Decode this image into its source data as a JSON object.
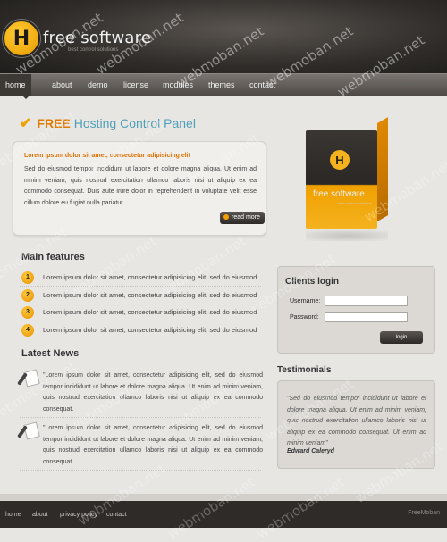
{
  "header": {
    "logo_letter": "H",
    "brand": "free software",
    "tagline": "best control solutions"
  },
  "nav": {
    "items": [
      "home",
      "about",
      "demo",
      "license",
      "modules",
      "themes",
      "contact"
    ],
    "active": "home"
  },
  "hero": {
    "title_free": "FREE",
    "title_rest": "Hosting Control Panel"
  },
  "intro": {
    "heading": "Lorem ipsum dolor sit amet, consectetur adipisicing elit",
    "text": "Sed do eiusmod tempor incididunt ut labore et dolore magna aliqua. Ut enim ad minim veniam, quis nostrud exercitation ullamco laboris nisi ut aliquip ex ea commodo consequat. Duis aute irure dolor in reprehenderit in voluptate velit esse cillum dolore eu fugiat nulla pariatur.",
    "read_more": "read more"
  },
  "product_box": {
    "logo_letter": "H",
    "name": "free software",
    "tagline": "best control solutions"
  },
  "features": {
    "title": "Main features",
    "items": [
      {
        "number": "1",
        "text": "Lorem ipsum dolor sit amet, consectetur adipisicing elit, sed do eiusmod"
      },
      {
        "number": "2",
        "text": "Lorem ipsum dolor sit amet, consectetur adipisicing elit, sed do eiusmod"
      },
      {
        "number": "3",
        "text": "Lorem ipsum dolor sit amet, consectetur adipisicing elit, sed do eiusmod"
      },
      {
        "number": "4",
        "text": "Lorem ipsum dolor sit amet, consectetur adipisicing elit, sed do eiusmod"
      }
    ]
  },
  "news": {
    "title": "Latest News",
    "items": [
      {
        "text": "\"Lorem ipsum dolor sit amet, consectetur adipisicing elit, sed do eiusmod tempor incididunt ut labore et dolore magna aliqua. Ut enim ad minim veniam, quis nostrud exercitation ullamco laboris nisi ut aliquip ex ea commodo consequat."
      },
      {
        "text": "\"Lorem ipsum dolor sit amet, consectetur adipisicing elit, sed do eiusmod tempor incididunt ut labore et dolore magna aliqua. Ut enim ad minim veniam, quis nostrud exercitation ullamco laboris nisi ut aliquip ex ea commodo consequat."
      }
    ]
  },
  "login": {
    "title": "Clients login",
    "username_label": "Username:",
    "password_label": "Password:",
    "username_value": "",
    "password_value": "",
    "button": "login"
  },
  "testimonials": {
    "title": "Testimonials",
    "quote": "\"Sed do eiusmod tempor incididunt ut labore et dolore magna aliqua. Ut enim ad minim veniam, quis nostrud exercitation ullamco laboris nisi ut aliquip ex ea commodo consequat. Ut enim ad minim veniam\"",
    "author": "Edward Caleryd"
  },
  "footer": {
    "links": [
      "home",
      "about",
      "privacy policy",
      "contact"
    ],
    "credit": "FreeMoban"
  },
  "watermark": "webmoban.net",
  "colors": {
    "accent_orange": "#e07a00",
    "heading_teal": "#4ea0b8",
    "bullet_yellow": "#f0a000",
    "header_dark": "#2f2c29"
  }
}
